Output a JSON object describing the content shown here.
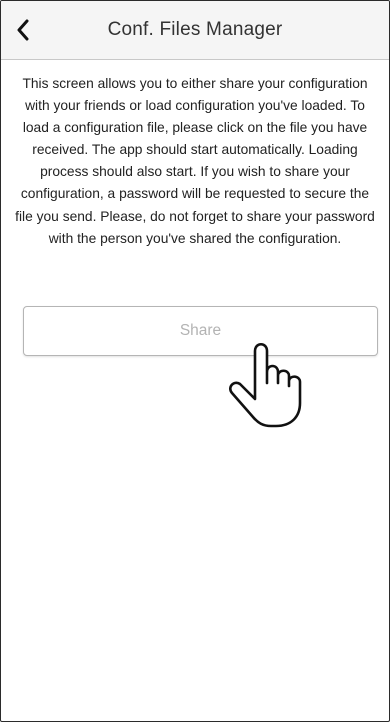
{
  "header": {
    "title": "Conf. Files Manager",
    "back_icon": "chevron-left-icon"
  },
  "main": {
    "description": "This screen allows you to either share your configuration with your friends or load configuration you've loaded. To load a configuration file, please click on the file you have received. The app should start automatically. Loading process should also start. If you wish to share your configuration, a password will be requested to secure the file you send. Please, do not forget to share your password with the person you've shared the configuration.",
    "share_button": {
      "label": "Share"
    }
  },
  "overlay": {
    "pointer_icon": "hand-pointer-icon"
  },
  "colors": {
    "nav_background": "#f5f5f5",
    "text": "#222222",
    "button_label": "#b3b3b3",
    "button_border": "#b5b5b5"
  }
}
